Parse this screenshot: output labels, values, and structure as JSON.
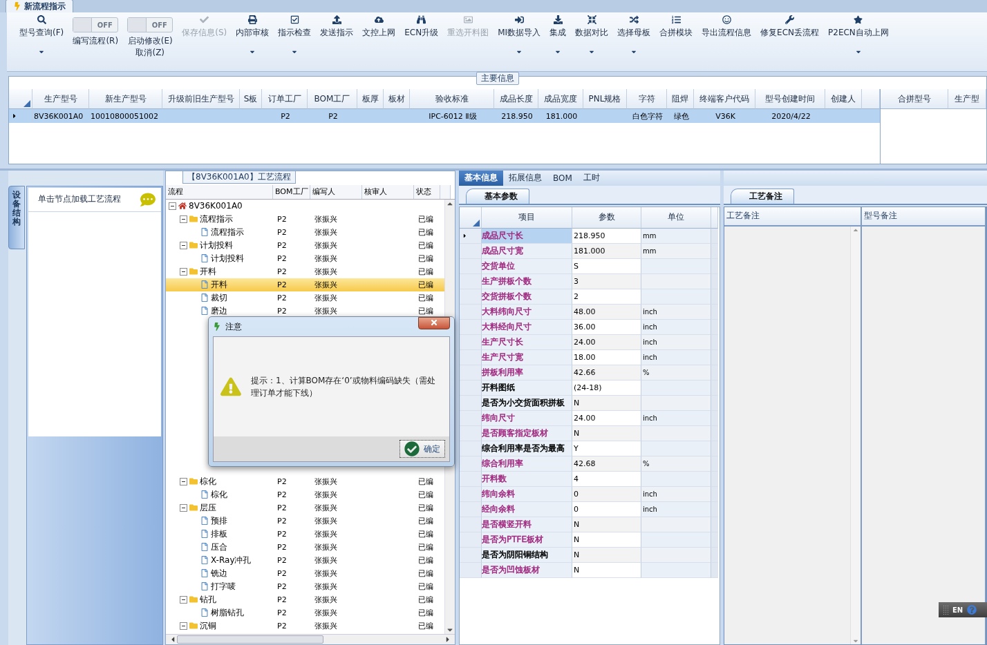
{
  "document_tab": {
    "title": "新流程指示"
  },
  "toolbar": [
    {
      "kind": "button",
      "label": "型号查询(F)",
      "disabled": false,
      "dropdown": true
    },
    {
      "kind": "toggle",
      "label": "编写流程(R)",
      "on": false,
      "toggle_text": "OFF"
    },
    {
      "kind": "toggle",
      "label": "启动修改(E)\n取消(Z)",
      "on": false,
      "toggle_text": "OFF"
    },
    {
      "kind": "button",
      "label": "保存信息(S)",
      "disabled": true,
      "dropdown": false
    },
    {
      "kind": "button",
      "label": "内部审核",
      "disabled": false,
      "dropdown": true
    },
    {
      "kind": "button",
      "label": "指示检查",
      "disabled": false,
      "dropdown": true
    },
    {
      "kind": "button",
      "label": "发送指示",
      "disabled": false,
      "dropdown": false
    },
    {
      "kind": "button",
      "label": "文控上网",
      "disabled": false,
      "dropdown": false
    },
    {
      "kind": "button",
      "label": "ECN升级",
      "disabled": false,
      "dropdown": false
    },
    {
      "kind": "button",
      "label": "重选开料图",
      "disabled": true,
      "dropdown": false
    },
    {
      "kind": "button",
      "label": "MI数据导入",
      "disabled": false,
      "dropdown": true
    },
    {
      "kind": "button",
      "label": "集成",
      "disabled": false,
      "dropdown": true
    },
    {
      "kind": "button",
      "label": "数据对比",
      "disabled": false,
      "dropdown": true
    },
    {
      "kind": "button",
      "label": "选择母板",
      "disabled": false,
      "dropdown": true
    },
    {
      "kind": "button",
      "label": "合拼模块",
      "disabled": false,
      "dropdown": false
    },
    {
      "kind": "button",
      "label": "导出流程信息",
      "disabled": false,
      "dropdown": false
    },
    {
      "kind": "button",
      "label": "修复ECN丢流程",
      "disabled": false,
      "dropdown": false
    },
    {
      "kind": "button",
      "label": "P2ECN自动上网",
      "disabled": false,
      "dropdown": true
    }
  ],
  "main_info": {
    "title": "主要信息",
    "columns": [
      "生产型号",
      "新生产型号",
      "升级前旧生产型号",
      "S板",
      "订单工厂",
      "BOM工厂",
      "板厚",
      "板材",
      "验收标准",
      "成品长度",
      "成品宽度",
      "PNL规格",
      "字符",
      "阻焊",
      "终端客户代码",
      "型号创建时间",
      "创建人"
    ],
    "rows": [
      {
        "selected": true,
        "cells": [
          "8V36K001A0",
          "10010800051002",
          null,
          null,
          "P2",
          "P2",
          null,
          null,
          "IPC-6012 Ⅱ级",
          "218.950",
          "181.000",
          null,
          "白色字符",
          "绿色",
          "V36K",
          "2020/4/22",
          null
        ]
      }
    ],
    "side_columns": [
      "合拼型号",
      "生产型"
    ]
  },
  "left_panel": {
    "vertical_tab": "设备结构",
    "hint": "单击节点加载工艺流程"
  },
  "process_panel": {
    "title": "【8V36K001A0】工艺流程",
    "columns": [
      "流程",
      "BOM工厂",
      "编写人",
      "核审人",
      "状态"
    ],
    "tree": [
      {
        "kind": "root",
        "label": "8V36K001A0",
        "expanded": true,
        "selected": false,
        "children": [
          {
            "kind": "folder",
            "label": "流程指示",
            "bom": "P2",
            "writer": "张振兴",
            "status": "已编",
            "expanded": true,
            "selected": false,
            "children": [
              {
                "kind": "file",
                "label": "流程指示",
                "bom": "P2",
                "writer": "张振兴",
                "status": "已编",
                "selected": false
              }
            ]
          },
          {
            "kind": "folder",
            "label": "计划投料",
            "bom": "P2",
            "writer": "张振兴",
            "status": "已编",
            "expanded": true,
            "selected": false,
            "children": [
              {
                "kind": "file",
                "label": "计划投料",
                "bom": "P2",
                "writer": "张振兴",
                "status": "已编",
                "selected": false
              }
            ]
          },
          {
            "kind": "folder",
            "label": "开料",
            "bom": "P2",
            "writer": "张振兴",
            "status": "已编",
            "expanded": true,
            "selected": false,
            "children": [
              {
                "kind": "file",
                "label": "开料",
                "bom": "P2",
                "writer": "张振兴",
                "status": "已编",
                "selected": true
              },
              {
                "kind": "file",
                "label": "裁切",
                "bom": "P2",
                "writer": "张振兴",
                "status": "已编",
                "selected": false
              },
              {
                "kind": "file",
                "label": "磨边",
                "bom": "P2",
                "writer": "张振兴",
                "status": "已编",
                "selected": false
              }
            ]
          },
          {
            "kind": "covered"
          },
          {
            "kind": "folder",
            "label": "棕化",
            "bom": "P2",
            "writer": "张振兴",
            "status": "已编",
            "expanded": true,
            "selected": false,
            "children": [
              {
                "kind": "file",
                "label": "棕化",
                "bom": "P2",
                "writer": "张振兴",
                "status": "已编",
                "selected": false
              }
            ]
          },
          {
            "kind": "folder",
            "label": "层压",
            "bom": "P2",
            "writer": "张振兴",
            "status": "已编",
            "expanded": true,
            "selected": false,
            "children": [
              {
                "kind": "file",
                "label": "预排",
                "bom": "P2",
                "writer": "张振兴",
                "status": "已编",
                "selected": false
              },
              {
                "kind": "file",
                "label": "排板",
                "bom": "P2",
                "writer": "张振兴",
                "status": "已编",
                "selected": false
              },
              {
                "kind": "file",
                "label": "压合",
                "bom": "P2",
                "writer": "张振兴",
                "status": "已编",
                "selected": false
              },
              {
                "kind": "file",
                "label": "X-Ray冲孔",
                "bom": "P2",
                "writer": "张振兴",
                "status": "已编",
                "selected": false
              },
              {
                "kind": "file",
                "label": "铣边",
                "bom": "P2",
                "writer": "张振兴",
                "status": "已编",
                "selected": false
              },
              {
                "kind": "file",
                "label": "打字唛",
                "bom": "P2",
                "writer": "张振兴",
                "status": "已编",
                "selected": false
              }
            ]
          },
          {
            "kind": "folder",
            "label": "钻孔",
            "bom": "P2",
            "writer": "张振兴",
            "status": "已编",
            "expanded": true,
            "selected": false,
            "children": [
              {
                "kind": "file",
                "label": "树脂钻孔",
                "bom": "P2",
                "writer": "张振兴",
                "status": "已编",
                "selected": false
              }
            ]
          },
          {
            "kind": "folder",
            "label": "沉铜",
            "bom": "P2",
            "writer": "张振兴",
            "status": "已编",
            "expanded": true,
            "selected": false
          }
        ]
      }
    ]
  },
  "detail_tabs": [
    {
      "label": "基本信息",
      "selected": true
    },
    {
      "label": "拓展信息",
      "selected": false
    },
    {
      "label": "BOM",
      "selected": false
    },
    {
      "label": "工时",
      "selected": false
    }
  ],
  "params": {
    "tab": "基本参数",
    "columns": [
      "项目",
      "参数",
      "单位"
    ],
    "rows": [
      {
        "name": "成品尺寸长",
        "value": "218.950",
        "unit": "mm",
        "color": "#a0287f",
        "selected": true
      },
      {
        "name": "成品尺寸宽",
        "value": "181.000",
        "unit": "mm",
        "color": "#a0287f",
        "selected": false
      },
      {
        "name": "交货单位",
        "value": "S",
        "unit": null,
        "color": "#a0287f",
        "selected": false
      },
      {
        "name": "生产拼板个数",
        "value": "3",
        "unit": null,
        "color": "#a0287f",
        "selected": false
      },
      {
        "name": "交货拼板个数",
        "value": "2",
        "unit": null,
        "color": "#a0287f",
        "selected": false
      },
      {
        "name": "大料纬向尺寸",
        "value": "48.00",
        "unit": "inch",
        "color": "#a0287f",
        "selected": false
      },
      {
        "name": "大料经向尺寸",
        "value": "36.00",
        "unit": "inch",
        "color": "#a0287f",
        "selected": false
      },
      {
        "name": "生产尺寸长",
        "value": "24.00",
        "unit": "inch",
        "color": "#a0287f",
        "selected": false
      },
      {
        "name": "生产尺寸宽",
        "value": "18.00",
        "unit": "inch",
        "color": "#a0287f",
        "selected": false
      },
      {
        "name": "拼板利用率",
        "value": "42.66",
        "unit": "%",
        "color": "#a0287f",
        "selected": false
      },
      {
        "name": "开料图纸",
        "value": "(24-18)",
        "unit": null,
        "color": "#000000",
        "selected": false
      },
      {
        "name": "是否为小交货面积拼板",
        "value": "N",
        "unit": null,
        "color": "#000000",
        "selected": false
      },
      {
        "name": "纬向尺寸",
        "value": "24.00",
        "unit": "inch",
        "color": "#a0287f",
        "selected": false
      },
      {
        "name": "是否顾客指定板材",
        "value": "N",
        "unit": null,
        "color": "#a0287f",
        "selected": false
      },
      {
        "name": "综合利用率是否为最高",
        "value": "Y",
        "unit": null,
        "color": "#000000",
        "selected": false
      },
      {
        "name": "综合利用率",
        "value": "42.68",
        "unit": "%",
        "color": "#a0287f",
        "selected": false
      },
      {
        "name": "开料数",
        "value": "4",
        "unit": null,
        "color": "#a0287f",
        "selected": false
      },
      {
        "name": "纬向余料",
        "value": "0",
        "unit": "inch",
        "color": "#a0287f",
        "selected": false
      },
      {
        "name": "经向余料",
        "value": "0",
        "unit": "inch",
        "color": "#a0287f",
        "selected": false
      },
      {
        "name": "是否横竖开料",
        "value": "N",
        "unit": null,
        "color": "#a0287f",
        "selected": false
      },
      {
        "name": "是否为PTFE板材",
        "value": "N",
        "unit": null,
        "color": "#a0287f",
        "selected": false
      },
      {
        "name": "是否为阴阳铜结构",
        "value": "N",
        "unit": null,
        "color": "#000000",
        "selected": false
      },
      {
        "name": "是否为凹蚀板材",
        "value": "N",
        "unit": null,
        "color": "#a0287f",
        "selected": false
      }
    ]
  },
  "notes": {
    "tab": "工艺备注",
    "columns": [
      "工艺备注",
      "型号备注"
    ]
  },
  "dialog": {
    "title": "注意",
    "message": "提示：1、计算BOM存在‘0’或物料编码缺失（需处理订单才能下线）",
    "ok": "确定"
  },
  "ime_bar": {
    "language": "EN"
  }
}
